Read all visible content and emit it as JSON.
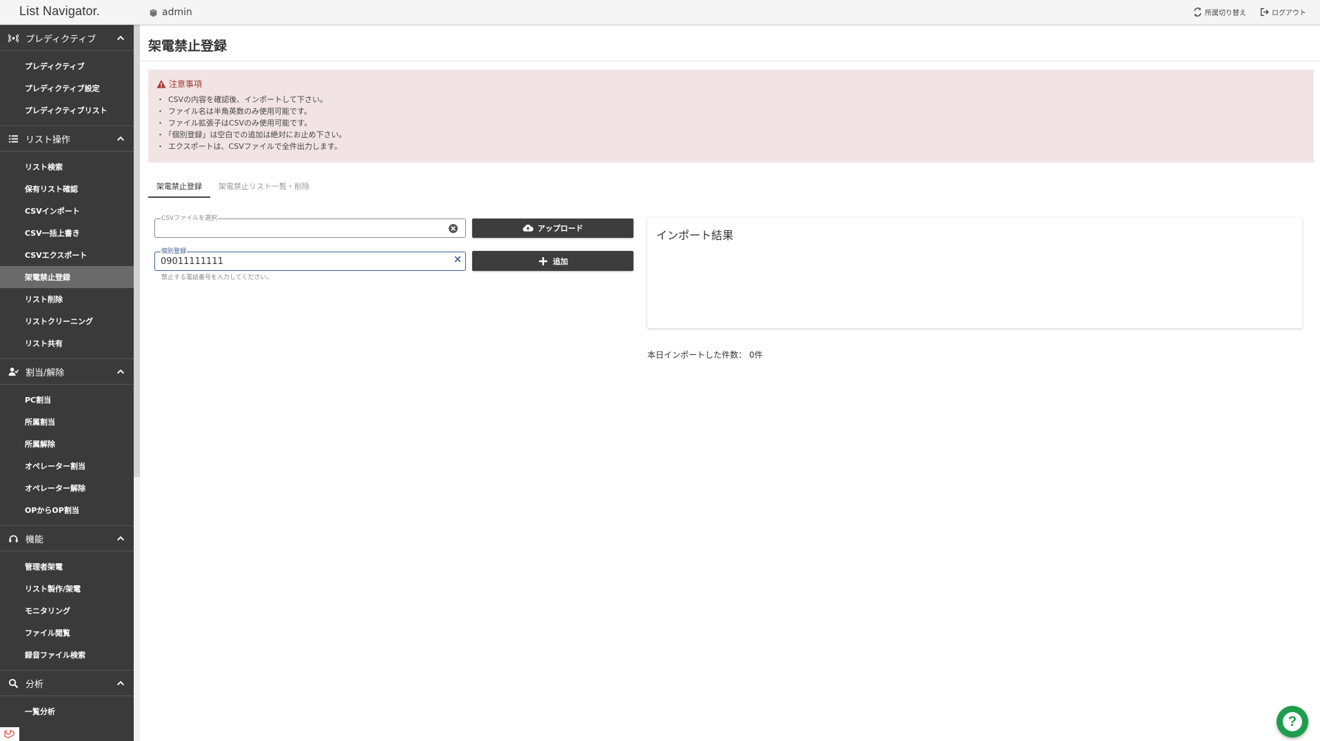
{
  "header": {
    "brand": "List Navigator.",
    "user": "admin",
    "switch_label": "所属切り替え",
    "logout_label": "ログアウト"
  },
  "sidebar": {
    "sections": [
      {
        "title": "プレディクティブ",
        "icon": "broadcast-icon",
        "items": [
          "プレディクティブ",
          "プレディクティブ設定",
          "プレディクティブリスト"
        ]
      },
      {
        "title": "リスト操作",
        "icon": "list-icon",
        "items": [
          "リスト検索",
          "保有リスト確認",
          "CSVインポート",
          "CSV一括上書き",
          "CSVエクスポート",
          "架電禁止登録",
          "リスト削除",
          "リストクリーニング",
          "リスト共有"
        ]
      },
      {
        "title": "割当/解除",
        "icon": "user-check-icon",
        "items": [
          "PC割当",
          "所属割当",
          "所属解除",
          "オペレーター割当",
          "オペレーター解除",
          "OPからOP割当"
        ]
      },
      {
        "title": "機能",
        "icon": "headset-icon",
        "items": [
          "管理者架電",
          "リスト製作/架電",
          "モニタリング",
          "ファイル閲覧",
          "録音ファイル検索"
        ]
      },
      {
        "title": "分析",
        "icon": "search-icon",
        "items": [
          "一覧分析"
        ]
      }
    ],
    "active_item": "架電禁止登録"
  },
  "main": {
    "title": "架電禁止登録",
    "notice": {
      "heading": "注意事項",
      "items": [
        "CSVの内容を確認後、インポートして下さい。",
        "ファイル名は半角英数のみ使用可能です。",
        "ファイル拡張子はCSVのみ使用可能です。",
        "「個別登録」は空白での追加は絶対にお止め下さい。",
        "エクスポートは、CSVファイルで全件出力します。"
      ]
    },
    "tabs": [
      "架電禁止登録",
      "架電禁止リスト一覧・削除"
    ],
    "active_tab": 0,
    "csv_field": {
      "label": "CSVファイルを選択",
      "value": ""
    },
    "upload_button": "アップロード",
    "single_field": {
      "label": "個別登録",
      "value": "09011111111",
      "hint": "禁止する電話番号を入力してください。"
    },
    "add_button": "追加",
    "result_title": "インポート結果",
    "import_count_label": "本日インポートした件数：",
    "import_count_value": "0件"
  },
  "colors": {
    "sidebar_bg": "#3a3a3a",
    "active_item_bg": "#6a6a6a",
    "notice_bg": "#f2e4e4",
    "notice_heading": "#a33a3a",
    "button_bg": "#3d3d3d",
    "help_fab": "#1f9d4e"
  }
}
